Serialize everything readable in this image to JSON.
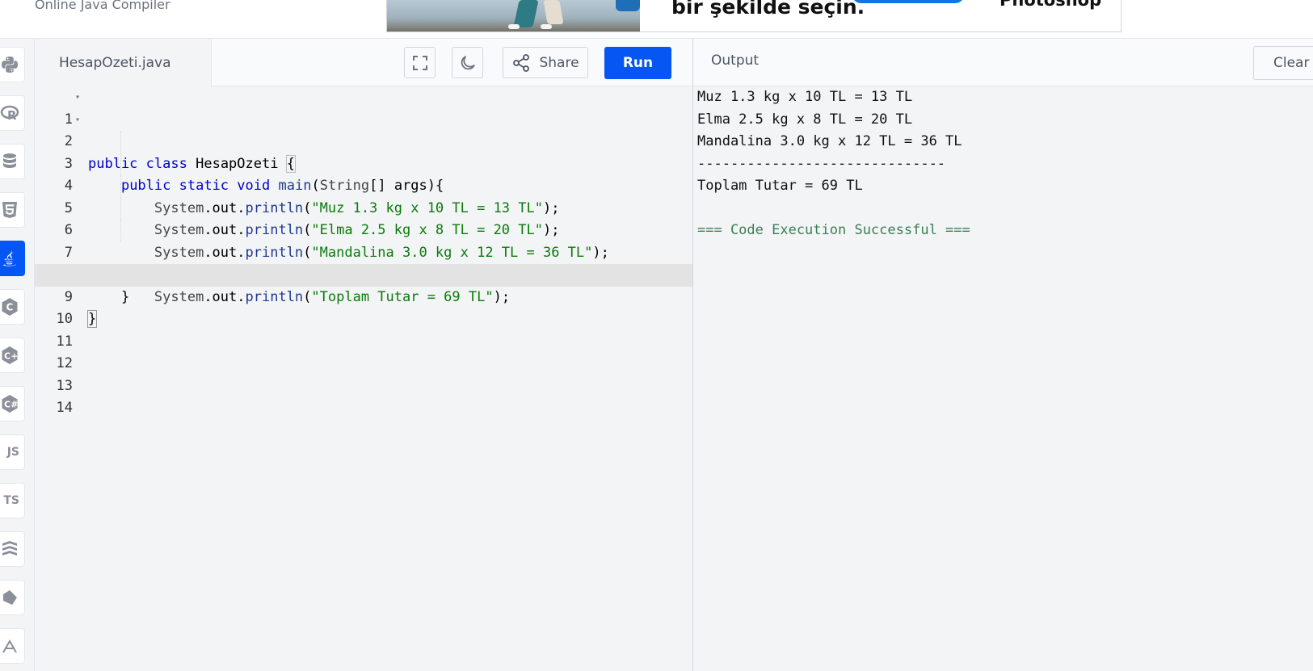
{
  "header": {
    "subtitle": "Online Java Compiler",
    "ad_text": "bir şekilde seçin.",
    "ad_brand": "Photoshop"
  },
  "sidebar": {
    "languages": [
      {
        "name": "python",
        "icon": "python-icon"
      },
      {
        "name": "r",
        "icon": "r-icon",
        "label": "R"
      },
      {
        "name": "sql",
        "icon": "database-icon"
      },
      {
        "name": "html",
        "icon": "html5-icon"
      },
      {
        "name": "java",
        "icon": "java-icon",
        "active": true
      },
      {
        "name": "c",
        "icon": "c-icon"
      },
      {
        "name": "cpp",
        "icon": "cpp-icon"
      },
      {
        "name": "csharp",
        "icon": "csharp-icon"
      },
      {
        "name": "javascript",
        "icon": "js-icon",
        "label": "JS"
      },
      {
        "name": "typescript",
        "icon": "ts-icon",
        "label": "TS"
      },
      {
        "name": "stack",
        "icon": "stack-icon"
      },
      {
        "name": "swift",
        "icon": "swift-icon"
      },
      {
        "name": "more",
        "icon": "lang-icon"
      }
    ]
  },
  "editor": {
    "filename": "HesapOzeti.java",
    "share_label": "Share",
    "run_label": "Run",
    "line_numbers": [
      "1",
      "2",
      "3",
      "4",
      "5",
      "6",
      "7",
      "8",
      "9",
      "10",
      "11",
      "12",
      "13",
      "14"
    ],
    "code": {
      "l1_kw1": "public",
      "l1_kw2": "class",
      "l1_name": "HesapOzeti",
      "l1_brace": "{",
      "l2_kw1": "public",
      "l2_kw2": "static",
      "l2_kw3": "void",
      "l2_fn": "main",
      "l2_cls": "String",
      "l2_rest": "[] args){",
      "sys": "System",
      "dot_out": ".out.",
      "println": "println",
      "l3_str": "\"Muz 1.3 kg x 10 TL = 13 TL\"",
      "l4_str": "\"Elma 2.5 kg x 8 TL = 20 TL\"",
      "l5_str": "\"Mandalina 3.0 kg x 12 TL = 36 TL\"",
      "l6_str": "\"------------------------------\"",
      "l7_str": "\"Toplam Tutar = 69 TL\"",
      "open_paren": "(",
      "close": ");",
      "l8": "}",
      "l9": "}"
    }
  },
  "output": {
    "title": "Output",
    "clear_label": "Clear",
    "lines": [
      "Muz 1.3 kg x 10 TL = 13 TL",
      "Elma 2.5 kg x 8 TL = 20 TL",
      "Mandalina 3.0 kg x 12 TL = 36 TL",
      "------------------------------",
      "Toplam Tutar = 69 TL",
      "",
      "=== Code Execution Successful ==="
    ]
  },
  "colors": {
    "accent": "#0556f3",
    "keyword": "#0000cd",
    "string": "#0a7a0a",
    "success": "#3d7d55"
  }
}
